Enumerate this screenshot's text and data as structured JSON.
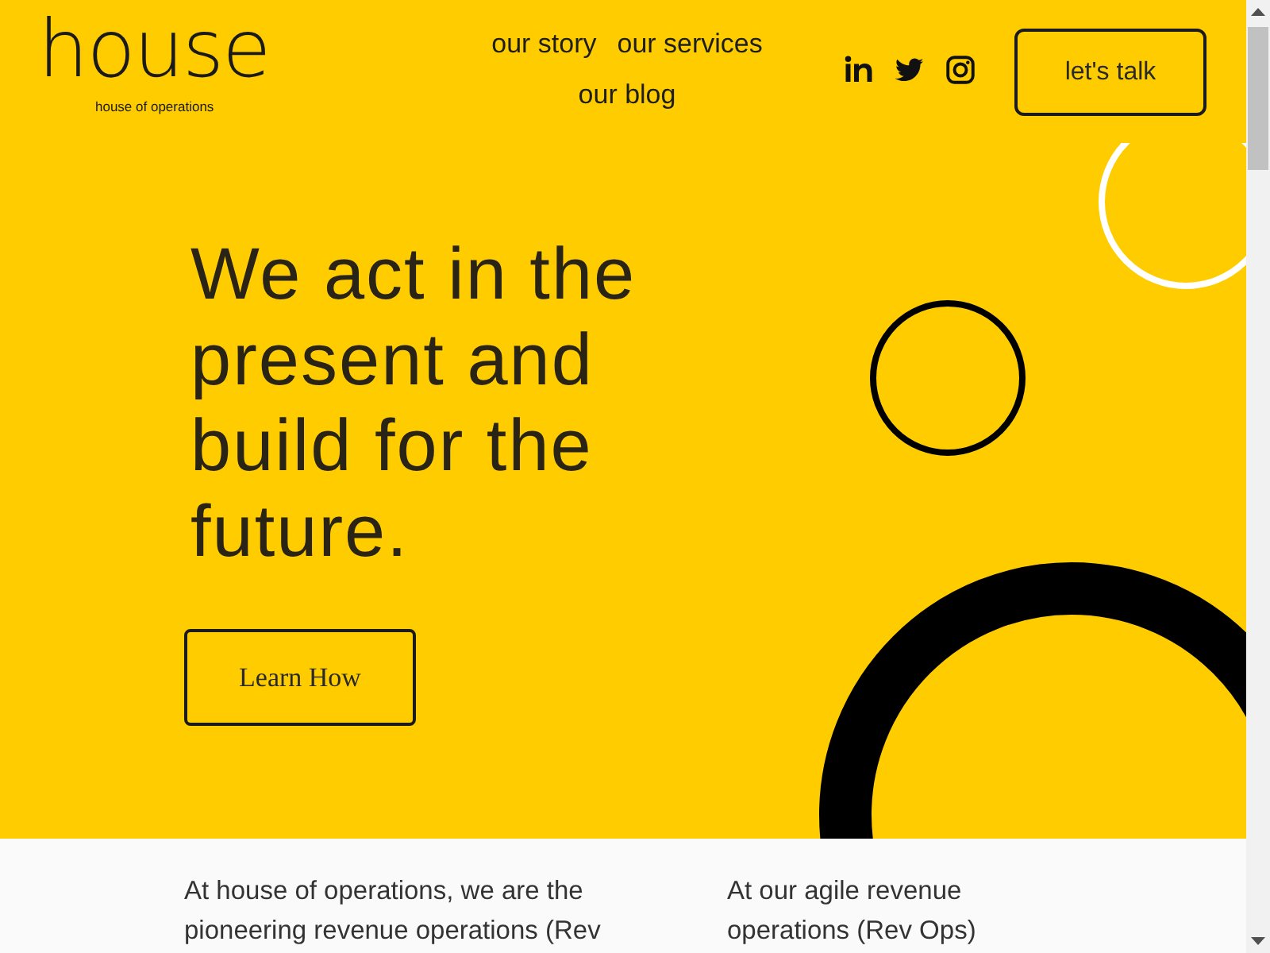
{
  "header": {
    "logo": {
      "wordmark": "house",
      "tagline": "house of operations"
    },
    "nav": [
      {
        "label": "our story"
      },
      {
        "label": "our services"
      },
      {
        "label": "our blog"
      }
    ],
    "cta_button": "let's talk"
  },
  "hero": {
    "headline": "We act in the present and build for the future.",
    "button": "Learn How"
  },
  "intro": {
    "columns": [
      "At house of operations, we are the pioneering revenue operations (Rev",
      "At our agile revenue operations (Rev Ops)"
    ]
  }
}
